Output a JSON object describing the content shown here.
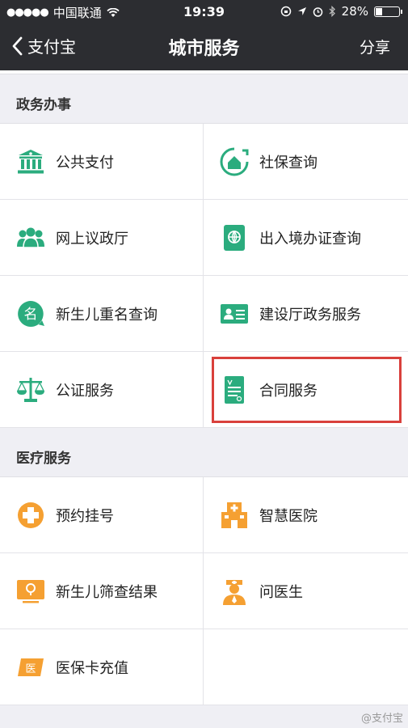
{
  "status_bar": {
    "carrier": "中国联通",
    "time": "19:39",
    "battery": "28%",
    "battery_level": 0.28
  },
  "nav": {
    "back_label": "支付宝",
    "title": "城市服务",
    "share_label": "分享"
  },
  "sections": [
    {
      "title": "政务办事",
      "items": [
        {
          "label": "公共支付",
          "icon": "bank-icon"
        },
        {
          "label": "社保查询",
          "icon": "house-circle-icon"
        },
        {
          "label": "网上议政厅",
          "icon": "people-icon"
        },
        {
          "label": "出入境办证查询",
          "icon": "passport-icon"
        },
        {
          "label": "新生儿重名查询",
          "icon": "name-bubble-icon"
        },
        {
          "label": "建设厅政务服务",
          "icon": "id-card-icon"
        },
        {
          "label": "公证服务",
          "icon": "scales-icon"
        },
        {
          "label": "合同服务",
          "icon": "contract-document-icon"
        }
      ]
    },
    {
      "title": "医疗服务",
      "items": [
        {
          "label": "预约挂号",
          "icon": "medical-cross-icon"
        },
        {
          "label": "智慧医院",
          "icon": "hospital-icon"
        },
        {
          "label": "新生儿筛查结果",
          "icon": "baby-screening-icon"
        },
        {
          "label": "问医生",
          "icon": "doctor-icon"
        },
        {
          "label": "医保卡充值",
          "icon": "medical-card-icon"
        }
      ]
    }
  ],
  "watermark": "@支付宝",
  "colors": {
    "green": "#2bac7e",
    "orange": "#f5a032",
    "highlight": "#d9403c",
    "nav_bg": "#2c2d31"
  }
}
